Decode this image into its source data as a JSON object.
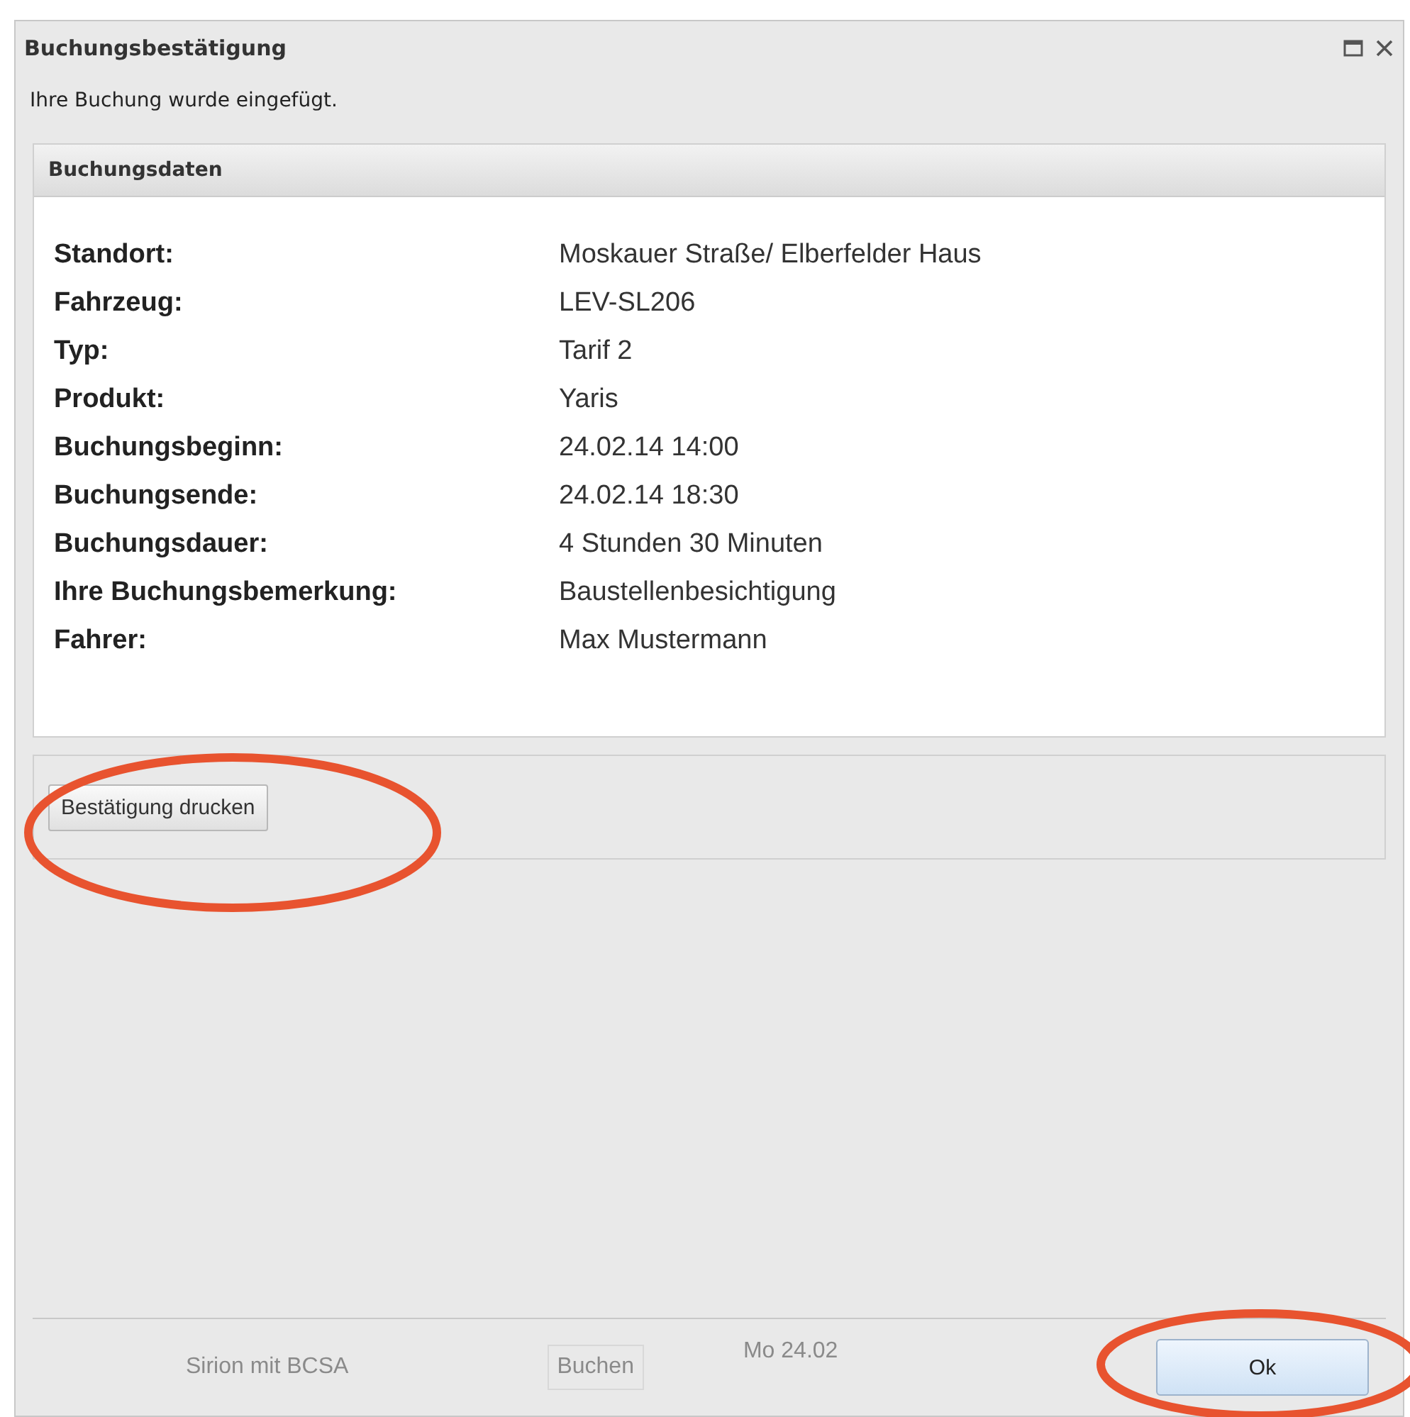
{
  "window": {
    "title": "Buchungsbestätigung"
  },
  "message": "Ihre Buchung wurde eingefügt.",
  "panel": {
    "title": "Buchungsdaten",
    "rows": [
      {
        "label": "Standort:",
        "value": "Moskauer Straße/ Elberfelder Haus"
      },
      {
        "label": "Fahrzeug:",
        "value": "LEV-SL206"
      },
      {
        "label": "Typ:",
        "value": "Tarif 2"
      },
      {
        "label": "Produkt:",
        "value": "Yaris"
      },
      {
        "label": "Buchungsbeginn:",
        "value": "24.02.14 14:00"
      },
      {
        "label": "Buchungsende:",
        "value": "24.02.14 18:30"
      },
      {
        "label": "Buchungsdauer:",
        "value": "4 Stunden 30 Minuten"
      },
      {
        "label": "Ihre Buchungsbemerkung:",
        "value": "Baustellenbesichtigung"
      },
      {
        "label": "Fahrer:",
        "value": "Max Mustermann"
      }
    ]
  },
  "print_button": "Bestätigung drucken",
  "background_footer": {
    "vehicle": "Sirion mit BCSA",
    "book_button": "Buchen",
    "date": "Mo 24.02"
  },
  "ok_button": "Ok"
}
